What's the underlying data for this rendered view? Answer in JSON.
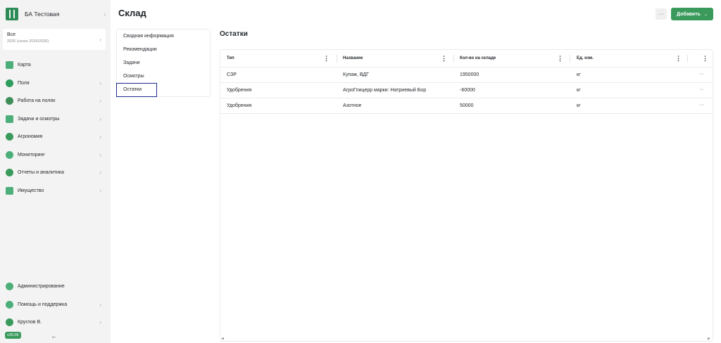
{
  "sidebar": {
    "org_name": "БА Тестовая",
    "season": {
      "title": "Все",
      "subtitle": "2026 (сезон 2025/2026)"
    },
    "items": [
      {
        "label": "Карта",
        "icon": "map-icon",
        "color": "#4caf7a",
        "has_chevron": false
      },
      {
        "label": "Поля",
        "icon": "fields-icon",
        "color": "#2e9d5e",
        "has_chevron": true
      },
      {
        "label": "Работа на полях",
        "icon": "tractor-icon",
        "color": "#3e8e5a",
        "has_chevron": true
      },
      {
        "label": "Задачи и осмотры",
        "icon": "clipboard-icon",
        "color": "#4caf7a",
        "has_chevron": true
      },
      {
        "label": "Агрономия",
        "icon": "leaf-icon",
        "color": "#3a9a5c",
        "has_chevron": true
      },
      {
        "label": "Мониторинг",
        "icon": "monitoring-icon",
        "color": "#4caf7a",
        "has_chevron": true
      },
      {
        "label": "Отчеты и аналитика",
        "icon": "chart-pie-icon",
        "color": "#3a9a5c",
        "has_chevron": true
      },
      {
        "label": "Имущество",
        "icon": "warehouse-icon",
        "color": "#4caf7a",
        "has_chevron": true
      }
    ],
    "bottom_items": [
      {
        "label": "Администрирование",
        "icon": "admin-icon",
        "color": "#4caf7a",
        "has_chevron": false
      },
      {
        "label": "Помощь и поддержка",
        "icon": "help-icon",
        "color": "#4caf7a",
        "has_chevron": true
      },
      {
        "label": "Круглов В.",
        "icon": "user-avatar-icon",
        "color": "#3a9a5c",
        "has_chevron": true
      }
    ],
    "version": "v26.06"
  },
  "header": {
    "title": "Склад",
    "more_label": "···",
    "add_label": "Добавить"
  },
  "subnav": {
    "items": [
      "Сводная информация",
      "Рекомендации",
      "Задачи",
      "Осмотры",
      "Остатки"
    ],
    "active": "Остатки"
  },
  "main": {
    "section_title": "Остатки",
    "table": {
      "columns": [
        "Тип",
        "Название",
        "Кол-во на складе",
        "Ед. изм."
      ],
      "rows": [
        [
          "СЗР",
          "Купаж, ВДГ",
          "1950000",
          "кг"
        ],
        [
          "Удобрения",
          "АгроГлицерр марки: Натриевый Бор",
          "-60000",
          "кг"
        ],
        [
          "Удобрения",
          "Азотное",
          "50000",
          "кг"
        ]
      ]
    }
  },
  "colors": {
    "accent": "#3a9a5c",
    "sidebar_bg": "#f3f3f3",
    "active_outline": "#1b2a8a"
  }
}
